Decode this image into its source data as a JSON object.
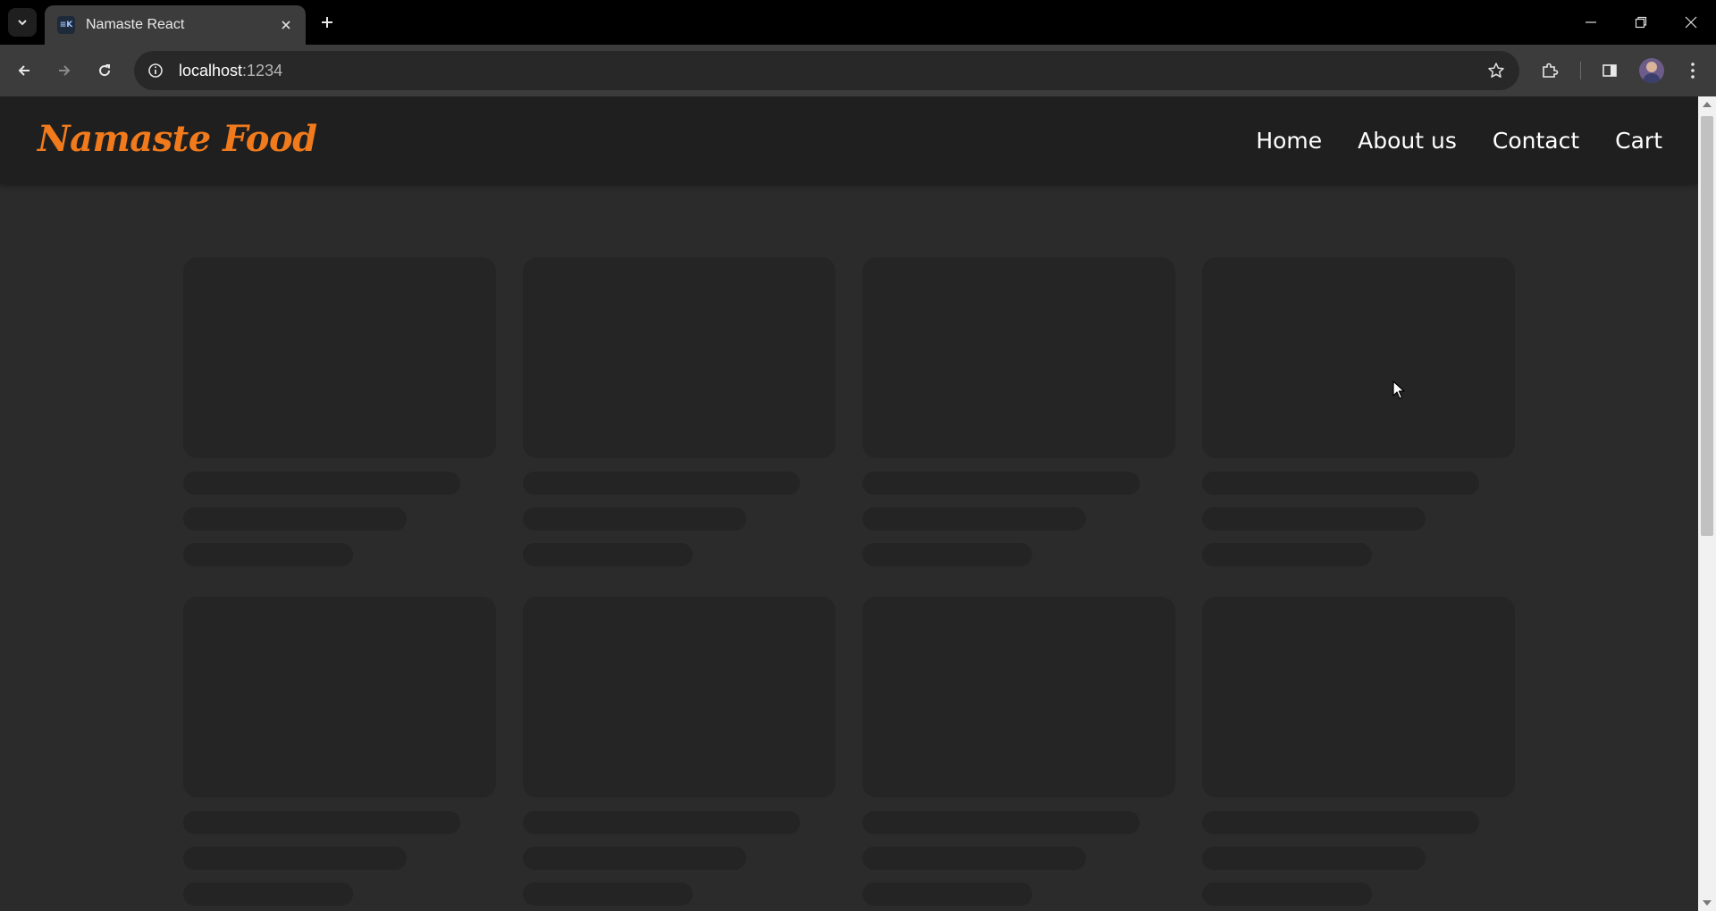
{
  "browser": {
    "tab": {
      "favicon_text": "≡K",
      "title": "Namaste React"
    },
    "address": {
      "host": "localhost",
      "port": ":1234"
    }
  },
  "site": {
    "logo": "Namaste Food",
    "logo_color": "#f07a1c",
    "nav": [
      "Home",
      "About us",
      "Contact",
      "Cart"
    ]
  },
  "shimmer": {
    "card_count": 8,
    "state": "loading"
  },
  "icons": {
    "tab_list": "chevron-down-icon",
    "tab_close": "close-icon",
    "new_tab": "plus-icon",
    "back": "arrow-left-icon",
    "forward": "arrow-right-icon",
    "reload": "reload-icon",
    "site_info": "info-icon",
    "bookmark": "star-icon",
    "extensions": "puzzle-icon",
    "side_panel": "side-panel-icon",
    "menu": "kebab-menu-icon"
  }
}
